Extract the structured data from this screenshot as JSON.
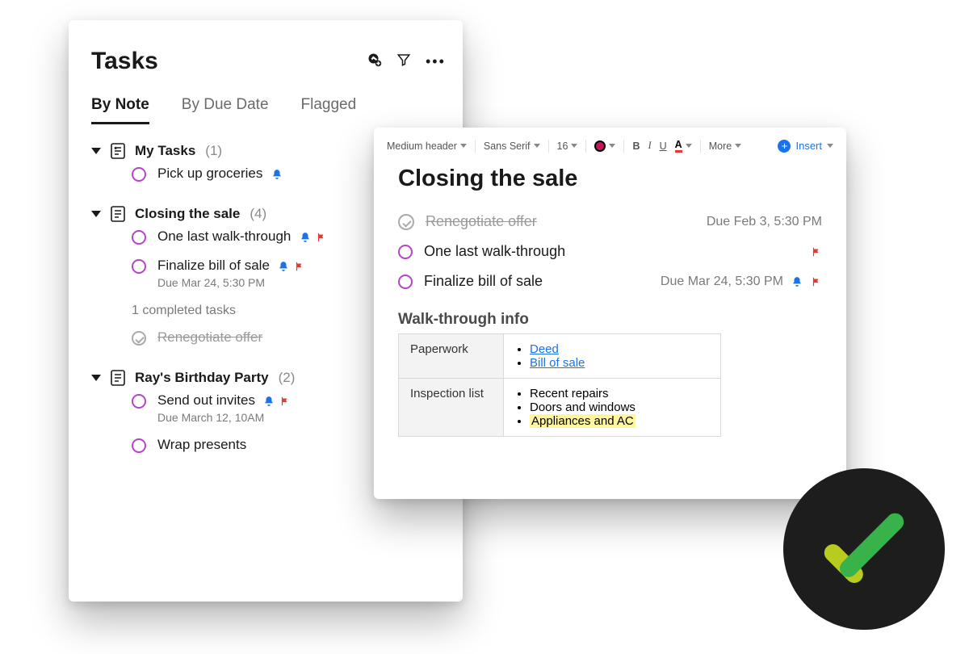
{
  "tasks_panel": {
    "title": "Tasks",
    "tabs": {
      "by_note": "By Note",
      "by_due": "By Due Date",
      "flagged": "Flagged"
    },
    "groups": [
      {
        "name": "My Tasks",
        "count_display": "(1)",
        "items": [
          {
            "text": "Pick up groceries",
            "has_bell": true
          }
        ]
      },
      {
        "name": "Closing the sale",
        "count_display": "(4)",
        "items": [
          {
            "text": "One last walk-through",
            "has_bell": true,
            "has_flag": true
          },
          {
            "text": "Finalize bill of sale",
            "subtext": "Due Mar 24, 5:30 PM",
            "has_bell": true,
            "has_flag": true
          }
        ],
        "completed_summary": "1 completed tasks",
        "completed_items": [
          {
            "text": "Renegotiate offer"
          }
        ]
      },
      {
        "name": "Ray's Birthday Party",
        "count_display": "(2)",
        "items": [
          {
            "text": "Send out invites",
            "subtext": "Due March 12, 10AM",
            "has_bell": true,
            "has_flag": true
          },
          {
            "text": "Wrap presents"
          }
        ]
      }
    ]
  },
  "editor": {
    "toolbar": {
      "style": "Medium header",
      "font": "Sans Serif",
      "size": "16",
      "more": "More",
      "insert": "Insert"
    },
    "title": "Closing the sale",
    "tasks": [
      {
        "text": "Renegotiate offer",
        "done": true,
        "due": "Due Feb 3, 5:30 PM"
      },
      {
        "text": "One last walk-through",
        "has_flag": true
      },
      {
        "text": "Finalize bill of sale",
        "due": "Due Mar 24, 5:30 PM",
        "has_bell": true,
        "has_flag": true
      }
    ],
    "section": "Walk-through info",
    "table": {
      "rows": [
        {
          "label": "Paperwork",
          "links": [
            "Deed",
            "Bill of sale"
          ]
        },
        {
          "label": "Inspection list",
          "items": [
            "Recent repairs",
            "Doors and windows"
          ],
          "highlighted": "Appliances and AC"
        }
      ]
    }
  }
}
